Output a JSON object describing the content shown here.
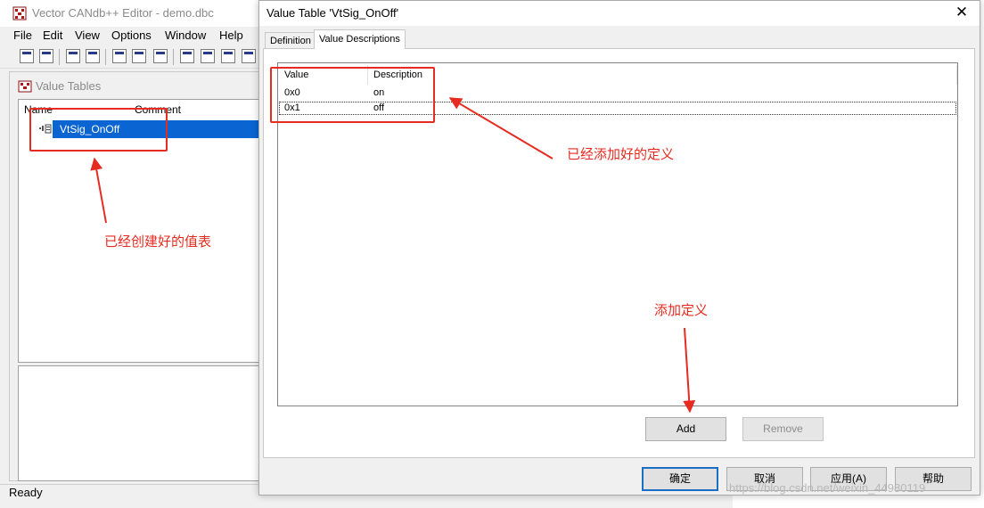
{
  "main_window": {
    "title": "Vector CANdb++ Editor - demo.dbc",
    "menu": [
      "File",
      "Edit",
      "View",
      "Options",
      "Window",
      "Help"
    ],
    "child_window": {
      "title": "Value Tables",
      "columns": [
        "Name",
        "Comment"
      ],
      "rows": [
        {
          "name": "VtSig_OnOff",
          "comment": ""
        }
      ]
    },
    "status": "Ready"
  },
  "dialog": {
    "title": "Value Table 'VtSig_OnOff'",
    "close_glyph": "✕",
    "tabs": [
      {
        "label": "Definition",
        "active": false
      },
      {
        "label": "Value Descriptions",
        "active": true
      }
    ],
    "columns": [
      "Value",
      "Description"
    ],
    "rows": [
      {
        "value": "0x0",
        "description": "on"
      },
      {
        "value": "0x1",
        "description": "off"
      }
    ],
    "add_label": "Add",
    "remove_label": "Remove",
    "ok_label": "确定",
    "cancel_label": "取消",
    "apply_label": "应用(A)",
    "help_label": "帮助"
  },
  "annotations": {
    "created_table": "已经创建好的值表",
    "added_definitions": "已经添加好的定义",
    "add_definition": "添加定义",
    "color": "#e62b20"
  },
  "watermark": "https://blog.csdn.net/weixin_44980119",
  "colors": {
    "selection": "#0a64d2",
    "default_button_border": "#1a6ec4",
    "annotation_red": "#e62b20"
  }
}
